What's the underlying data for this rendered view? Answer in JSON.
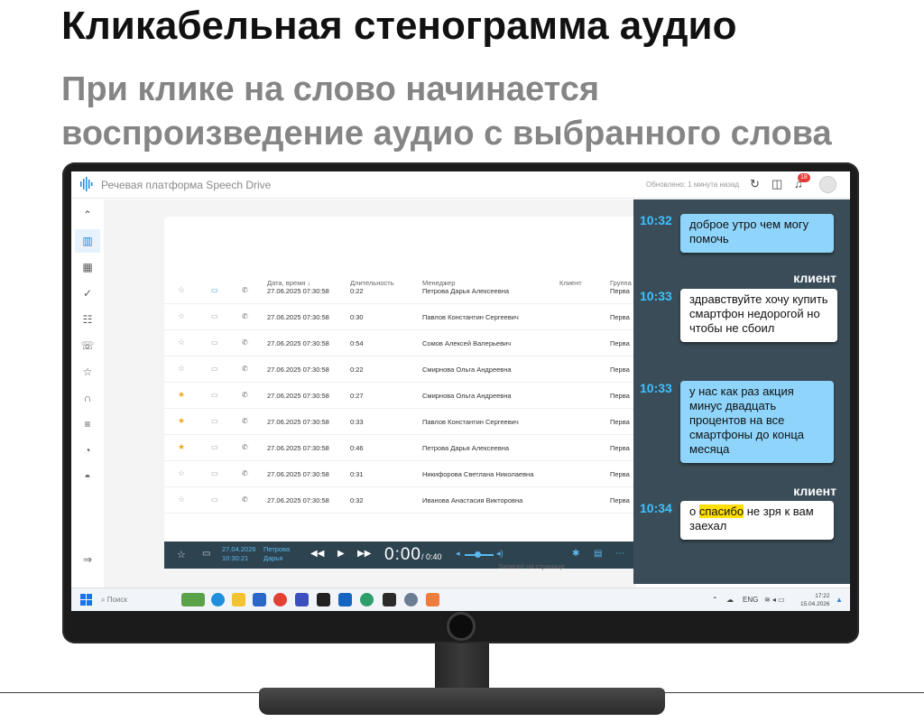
{
  "headline": "Кликабельная стенограмма аудио",
  "subheadline_line1": "При клике на слово начинается",
  "subheadline_line2": "воспроизведение аудио с выбранного слова",
  "app": {
    "title": "Речевая платформа Speech Drive",
    "updated": "Обновлено: 1 минута назад",
    "notifications_count": "18",
    "topbar_icons": [
      "refresh-icon",
      "book-icon",
      "bell-icon",
      "avatar-icon"
    ]
  },
  "sidebar": {
    "items": [
      {
        "name": "trend-icon",
        "glyph": "⌃",
        "active": false
      },
      {
        "name": "analytics-icon",
        "glyph": "▥",
        "active": true
      },
      {
        "name": "calendar-search-icon",
        "glyph": "▦",
        "active": false
      },
      {
        "name": "double-check-icon",
        "glyph": "✓",
        "active": false
      },
      {
        "name": "structure-icon",
        "glyph": "☷",
        "active": false
      },
      {
        "name": "call-end-icon",
        "glyph": "☏",
        "active": false
      },
      {
        "name": "star-icon",
        "glyph": "☆",
        "active": false
      },
      {
        "name": "headphones-icon",
        "glyph": "∩",
        "active": false
      },
      {
        "name": "checklist-icon",
        "glyph": "≡",
        "active": false
      },
      {
        "name": "gauge-icon",
        "glyph": "◔",
        "active": false
      },
      {
        "name": "incognito-icon",
        "glyph": "◓",
        "active": false
      }
    ],
    "collapse_glyph": "⇒"
  },
  "table": {
    "columns": [
      "Дата, время",
      "Длительность",
      "Менеджер",
      "Клиент",
      "Группа"
    ],
    "rows": [
      {
        "starred": false,
        "comment_blue": true,
        "datetime": "27.06.2025 07:30:58",
        "duration": "0:22",
        "manager": "Петрова Дарья Алексеевна",
        "group": "Перва"
      },
      {
        "starred": false,
        "comment_blue": false,
        "datetime": "27.06.2025 07:30:58",
        "duration": "0:30",
        "manager": "Павлов Константин Сергеевич",
        "group": "Перва"
      },
      {
        "starred": false,
        "comment_blue": false,
        "datetime": "27.06.2025 07:30:58",
        "duration": "0:54",
        "manager": "Сомов Алексей Валерьевич",
        "group": "Перва"
      },
      {
        "starred": false,
        "comment_blue": false,
        "datetime": "27.06.2025 07:30:58",
        "duration": "0:22",
        "manager": "Смирнова Ольга Андреевна",
        "group": "Перва"
      },
      {
        "starred": true,
        "comment_blue": false,
        "datetime": "27.06.2025 07:30:58",
        "duration": "0:27",
        "manager": "Смирнова Ольга Андреевна",
        "group": "Перва"
      },
      {
        "starred": true,
        "comment_blue": false,
        "datetime": "27.06.2025 07:30:58",
        "duration": "0:33",
        "manager": "Павлов Константин Сергеевич",
        "group": "Перва"
      },
      {
        "starred": true,
        "comment_blue": false,
        "datetime": "27.06.2025 07:30:58",
        "duration": "0:46",
        "manager": "Петрова Дарья Алексеевна",
        "group": "Перва"
      },
      {
        "starred": false,
        "comment_blue": false,
        "datetime": "27.06.2025 07:30:58",
        "duration": "0:31",
        "manager": "Никифорова Светлана Николаевна",
        "group": "Перва"
      },
      {
        "starred": false,
        "comment_blue": false,
        "datetime": "27.06.2025 07:30:58",
        "duration": "0:32",
        "manager": "Иванова Анастасия Викторовна",
        "group": "Перва"
      }
    ],
    "per_page_label": "Записей на странице"
  },
  "player": {
    "date": "27.04.2026",
    "time": "10:30:21",
    "manager_line1": "Петрова",
    "manager_line2": "Дарья",
    "current_time": "0:00",
    "total_time": "/ 0:40",
    "volume": 0.45
  },
  "transcript": {
    "messages": [
      {
        "time": "10:32",
        "speaker": "",
        "side": "manager",
        "words": [
          "доброе",
          "утро",
          "чем",
          "могу",
          "помочь"
        ],
        "highlight": -1
      },
      {
        "time": "10:33",
        "speaker": "клиент",
        "side": "client",
        "words": [
          "здравствуйте",
          "хочу",
          "купить",
          "смартфон",
          "недорогой",
          "но",
          "чтобы",
          "не",
          "сбоил"
        ],
        "highlight": -1
      },
      {
        "time": "10:33",
        "speaker": "",
        "side": "manager",
        "words": [
          "у",
          "нас",
          "как",
          "раз",
          "акция",
          "минус",
          "двадцать",
          "процентов",
          "на",
          "все",
          "смартфоны",
          "до",
          "конца",
          "месяца"
        ],
        "highlight": -1
      },
      {
        "time": "10:34",
        "speaker": "клиент",
        "side": "client",
        "words": [
          "о",
          "спасибо",
          "не",
          "зря",
          "к",
          "вам",
          "заехал"
        ],
        "highlight": 1
      }
    ]
  },
  "taskbar": {
    "search_placeholder": "Поиск",
    "language": "ENG",
    "clock_time": "17:22",
    "clock_date": "15.04.2026"
  },
  "colors": {
    "accent": "#1e88e5",
    "transcript_bg": "#3a4c57",
    "manager_bubble": "#8fd5fb",
    "client_bubble": "#ffffff",
    "time_label": "#3ec0ff",
    "highlight": "#ffe000",
    "star_on": "#f6a81c",
    "player_bg": "#2e4350"
  }
}
